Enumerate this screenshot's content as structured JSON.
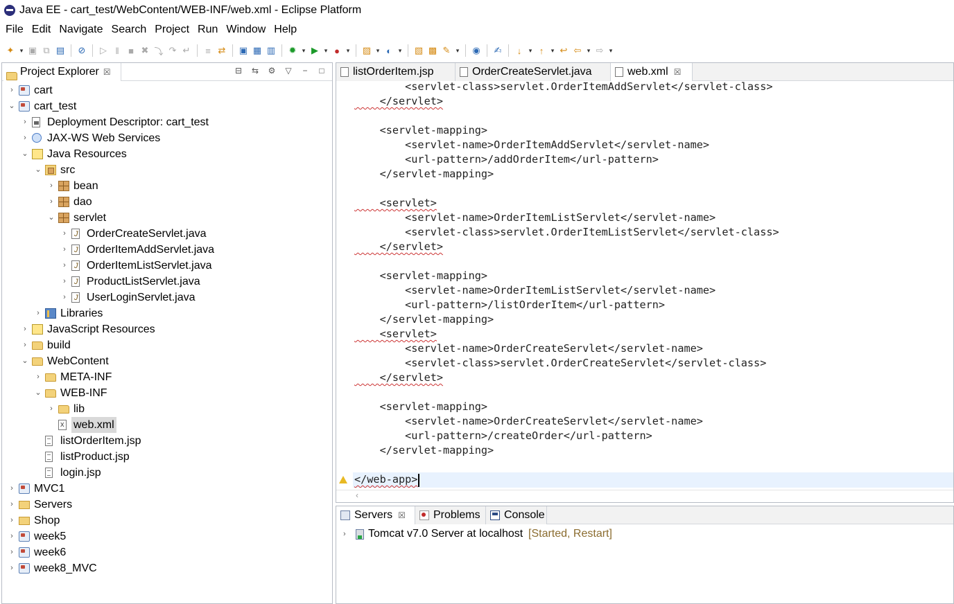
{
  "window": {
    "title": "Java EE - cart_test/WebContent/WEB-INF/web.xml - Eclipse Platform"
  },
  "menu": [
    "File",
    "Edit",
    "Navigate",
    "Search",
    "Project",
    "Run",
    "Window",
    "Help"
  ],
  "explorer": {
    "title": "Project Explorer",
    "close": "☒",
    "tree": [
      {
        "label": "cart",
        "depth": 0,
        "toggle": "›",
        "icon": "project-icon"
      },
      {
        "label": "cart_test",
        "depth": 0,
        "toggle": "⌄",
        "icon": "project-icon"
      },
      {
        "label": "Deployment Descriptor: cart_test",
        "depth": 1,
        "toggle": "›",
        "icon": "descriptor-icon"
      },
      {
        "label": "JAX-WS Web Services",
        "depth": 1,
        "toggle": "›",
        "icon": "web-services-icon"
      },
      {
        "label": "Java Resources",
        "depth": 1,
        "toggle": "⌄",
        "icon": "java-resources-icon"
      },
      {
        "label": "src",
        "depth": 2,
        "toggle": "⌄",
        "icon": "source-folder-icon"
      },
      {
        "label": "bean",
        "depth": 3,
        "toggle": "›",
        "icon": "package-icon"
      },
      {
        "label": "dao",
        "depth": 3,
        "toggle": "›",
        "icon": "package-icon"
      },
      {
        "label": "servlet",
        "depth": 3,
        "toggle": "⌄",
        "icon": "package-icon"
      },
      {
        "label": "OrderCreateServlet.java",
        "depth": 4,
        "toggle": "›",
        "icon": "java-file-icon"
      },
      {
        "label": "OrderItemAddServlet.java",
        "depth": 4,
        "toggle": "›",
        "icon": "java-file-icon"
      },
      {
        "label": "OrderItemListServlet.java",
        "depth": 4,
        "toggle": "›",
        "icon": "java-file-icon"
      },
      {
        "label": "ProductListServlet.java",
        "depth": 4,
        "toggle": "›",
        "icon": "java-file-icon"
      },
      {
        "label": "UserLoginServlet.java",
        "depth": 4,
        "toggle": "›",
        "icon": "java-file-icon"
      },
      {
        "label": "Libraries",
        "depth": 2,
        "toggle": "›",
        "icon": "library-icon"
      },
      {
        "label": "JavaScript Resources",
        "depth": 1,
        "toggle": "›",
        "icon": "javascript-resources-icon"
      },
      {
        "label": "build",
        "depth": 1,
        "toggle": "›",
        "icon": "folder-icon"
      },
      {
        "label": "WebContent",
        "depth": 1,
        "toggle": "⌄",
        "icon": "folder-icon"
      },
      {
        "label": "META-INF",
        "depth": 2,
        "toggle": "›",
        "icon": "folder-icon"
      },
      {
        "label": "WEB-INF",
        "depth": 2,
        "toggle": "⌄",
        "icon": "folder-icon"
      },
      {
        "label": "lib",
        "depth": 3,
        "toggle": "›",
        "icon": "folder-icon"
      },
      {
        "label": "web.xml",
        "depth": 3,
        "toggle": "",
        "icon": "xml-file-icon",
        "selected": true
      },
      {
        "label": "listOrderItem.jsp",
        "depth": 2,
        "toggle": "",
        "icon": "jsp-file-icon"
      },
      {
        "label": "listProduct.jsp",
        "depth": 2,
        "toggle": "",
        "icon": "jsp-file-icon"
      },
      {
        "label": "login.jsp",
        "depth": 2,
        "toggle": "",
        "icon": "jsp-file-icon"
      },
      {
        "label": "MVC1",
        "depth": 0,
        "toggle": "›",
        "icon": "project-icon"
      },
      {
        "label": "Servers",
        "depth": 0,
        "toggle": "›",
        "icon": "servers-folder-icon"
      },
      {
        "label": "Shop",
        "depth": 0,
        "toggle": "›",
        "icon": "servers-folder-icon"
      },
      {
        "label": "week5",
        "depth": 0,
        "toggle": "›",
        "icon": "project-icon"
      },
      {
        "label": "week6",
        "depth": 0,
        "toggle": "›",
        "icon": "project-icon"
      },
      {
        "label": "week8_MVC",
        "depth": 0,
        "toggle": "›",
        "icon": "project-icon"
      }
    ]
  },
  "editor": {
    "tabs": [
      {
        "label": "listOrderItem.jsp",
        "active": false
      },
      {
        "label": "OrderCreateServlet.java",
        "active": false
      },
      {
        "label": "web.xml",
        "active": true
      }
    ],
    "tab_close": "☒",
    "lines": [
      {
        "text": "        <servlet-class>servlet.OrderItemAddServlet</servlet-class>",
        "squiggle": false
      },
      {
        "text": "    </servlet>",
        "squiggle": true
      },
      {
        "text": "",
        "squiggle": false
      },
      {
        "text": "    <servlet-mapping>",
        "squiggle": false
      },
      {
        "text": "        <servlet-name>OrderItemAddServlet</servlet-name>",
        "squiggle": false
      },
      {
        "text": "        <url-pattern>/addOrderItem</url-pattern>",
        "squiggle": false
      },
      {
        "text": "    </servlet-mapping>",
        "squiggle": false
      },
      {
        "text": "",
        "squiggle": false
      },
      {
        "text": "    <servlet>",
        "squiggle": true
      },
      {
        "text": "        <servlet-name>OrderItemListServlet</servlet-name>",
        "squiggle": false
      },
      {
        "text": "        <servlet-class>servlet.OrderItemListServlet</servlet-class>",
        "squiggle": false
      },
      {
        "text": "    </servlet>",
        "squiggle": true
      },
      {
        "text": "",
        "squiggle": false
      },
      {
        "text": "    <servlet-mapping>",
        "squiggle": false
      },
      {
        "text": "        <servlet-name>OrderItemListServlet</servlet-name>",
        "squiggle": false
      },
      {
        "text": "        <url-pattern>/listOrderItem</url-pattern>",
        "squiggle": false
      },
      {
        "text": "    </servlet-mapping>",
        "squiggle": false
      },
      {
        "text": "    <servlet>",
        "squiggle": true
      },
      {
        "text": "        <servlet-name>OrderCreateServlet</servlet-name>",
        "squiggle": false
      },
      {
        "text": "        <servlet-class>servlet.OrderCreateServlet</servlet-class>",
        "squiggle": false
      },
      {
        "text": "    </servlet>",
        "squiggle": true
      },
      {
        "text": "",
        "squiggle": false
      },
      {
        "text": "    <servlet-mapping>",
        "squiggle": false
      },
      {
        "text": "        <servlet-name>OrderCreateServlet</servlet-name>",
        "squiggle": false
      },
      {
        "text": "        <url-pattern>/createOrder</url-pattern>",
        "squiggle": false
      },
      {
        "text": "    </servlet-mapping>",
        "squiggle": false
      },
      {
        "text": "",
        "squiggle": false
      },
      {
        "text": "</web-app>",
        "squiggle": true
      }
    ],
    "scroll_left": "‹"
  },
  "bottom_panel": {
    "tabs": [
      {
        "label": "Servers",
        "active": true,
        "close": "☒"
      },
      {
        "label": "Problems",
        "active": false,
        "close": ""
      },
      {
        "label": "Console",
        "active": false,
        "close": ""
      }
    ],
    "server": {
      "name": "Tomcat v7.0 Server at localhost",
      "state": "[Started, Restart]",
      "toggle": "›"
    }
  }
}
